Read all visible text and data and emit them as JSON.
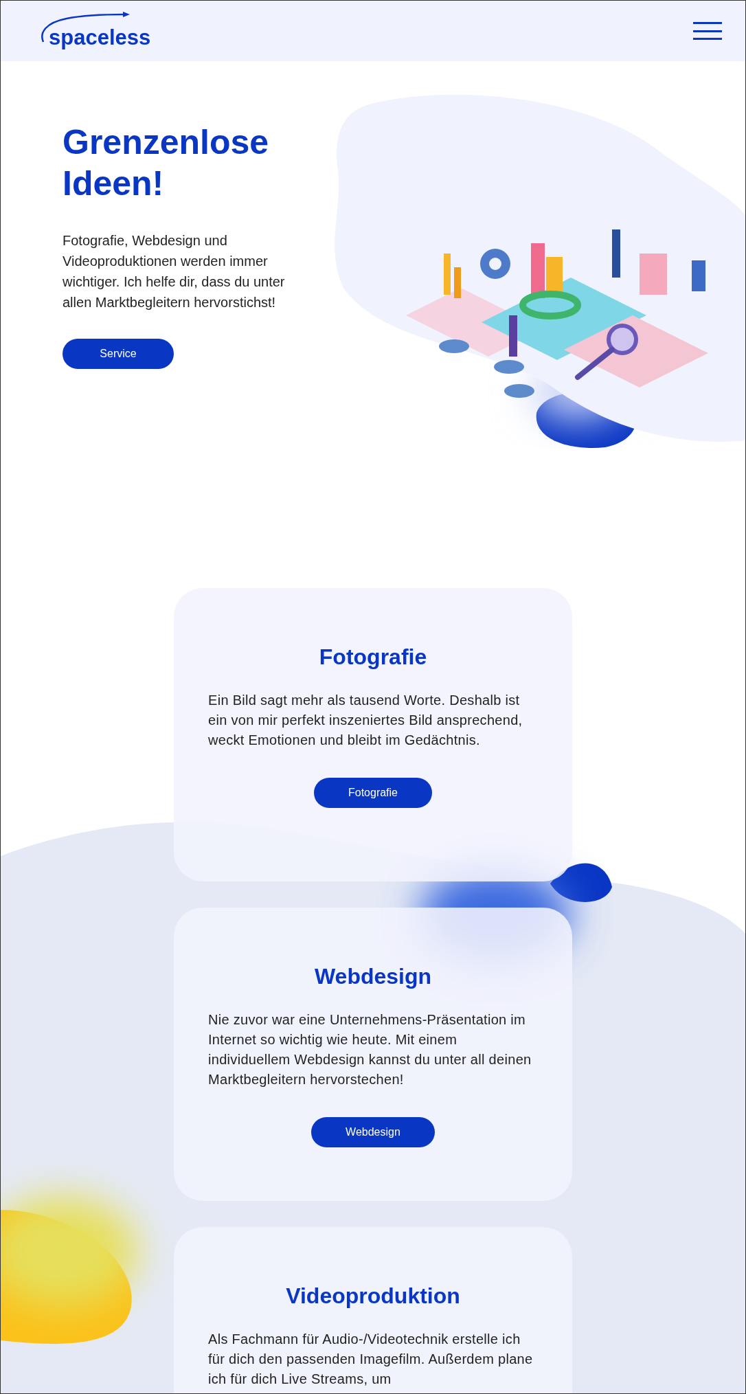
{
  "header": {
    "logo": "spaceless"
  },
  "hero": {
    "title": "Grenzenlose Ideen!",
    "text": "Fotografie, Webdesign und Videoproduktionen werden immer wichtiger. Ich helfe dir, dass du unter allen Marktbegleitern hervorstichst!",
    "button": "Service"
  },
  "services": [
    {
      "title": "Fotografie",
      "text": "Ein Bild sagt mehr als tausend Worte. Deshalb ist ein von mir perfekt inszeniertes Bild ansprechend, weckt Emotionen und bleibt im Gedächtnis.",
      "button": "Fotografie"
    },
    {
      "title": "Webdesign",
      "text": "Nie zuvor war eine Unternehmens-Präsentation im Internet so wichtig wie heute. Mit einem individuellem Webdesign kannst du unter all deinen Marktbegleitern hervorstechen!",
      "button": "Webdesign"
    },
    {
      "title": "Videoproduktion",
      "text": "Als Fachmann für Audio-/Videotechnik erstelle ich für dich den passenden Imagefilm. Außerdem plane ich für dich Live Streams, um"
    }
  ]
}
